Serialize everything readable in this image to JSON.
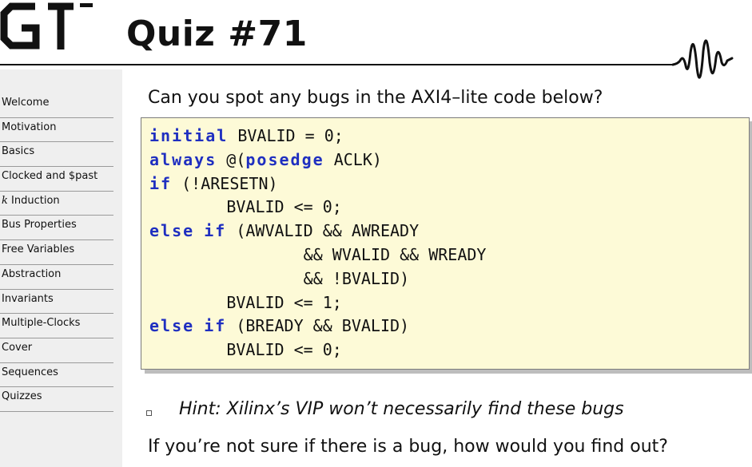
{
  "header": {
    "logo_text": "GT",
    "title": "Quiz #71"
  },
  "sidebar": {
    "items": [
      {
        "label": "Welcome"
      },
      {
        "label": "Motivation"
      },
      {
        "label": "Basics"
      },
      {
        "label": "Clocked and $past"
      },
      {
        "label": "Induction",
        "prefix": "k"
      },
      {
        "label": "Bus Properties"
      },
      {
        "label": "Free Variables"
      },
      {
        "label": "Abstraction"
      },
      {
        "label": "Invariants"
      },
      {
        "label": "Multiple-Clocks"
      },
      {
        "label": "Cover"
      },
      {
        "label": "Sequences"
      },
      {
        "label": "Quizzes"
      }
    ]
  },
  "main": {
    "question": "Can you spot any bugs in the AXI4–lite code below?",
    "code_lines": [
      [
        {
          "t": "initial",
          "kw": true
        },
        {
          "t": " BVALID = 0;"
        }
      ],
      [
        {
          "t": "always",
          "kw": true
        },
        {
          "t": " @("
        },
        {
          "t": "posedge",
          "kw": true
        },
        {
          "t": " ACLK)"
        }
      ],
      [
        {
          "t": "if",
          "kw": true
        },
        {
          "t": " (!ARESETN)"
        }
      ],
      [
        {
          "t": "        BVALID <= 0;"
        }
      ],
      [
        {
          "t": "else",
          "kw": true
        },
        {
          "t": " "
        },
        {
          "t": "if",
          "kw": true
        },
        {
          "t": " (AWVALID && AWREADY"
        }
      ],
      [
        {
          "t": "                && WVALID && WREADY"
        }
      ],
      [
        {
          "t": "                && !BVALID)"
        }
      ],
      [
        {
          "t": "        BVALID <= 1;"
        }
      ],
      [
        {
          "t": "else",
          "kw": true
        },
        {
          "t": " "
        },
        {
          "t": "if",
          "kw": true
        },
        {
          "t": " (BREADY && BVALID)"
        }
      ],
      [
        {
          "t": "        BVALID <= 0;"
        }
      ]
    ],
    "hint": "Hint: Xilinx’s VIP won’t necessarily find these bugs",
    "followup": "If you’re not sure if there is a bug, how would you find out?"
  },
  "colors": {
    "keyword": "#1f2fc0",
    "code_background": "#fdfad7",
    "sidebar_background": "#efefef"
  }
}
